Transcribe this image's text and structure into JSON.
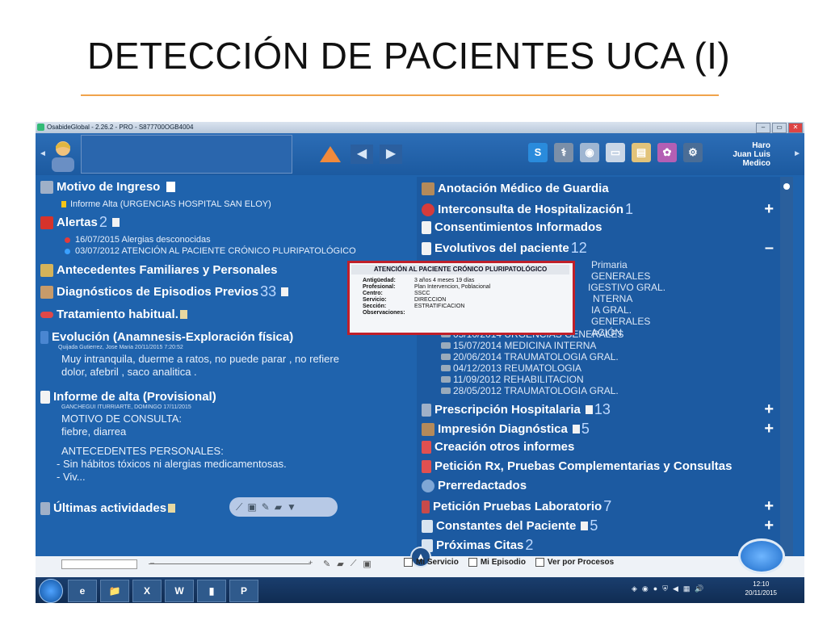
{
  "slide": {
    "title": "DETECCIÓN DE PACIENTES UCA (I)"
  },
  "window": {
    "title": "OsabideGlobal - 2.26.2 - PRO - S877700OGB4004",
    "buttons": [
      "–",
      "▭",
      "✕"
    ]
  },
  "header": {
    "user_name": "Haro",
    "user_first": "Juan Luis",
    "user_role": "Medico",
    "icons": [
      "s-icon",
      "doctor-icon",
      "monitor-icon",
      "card-icon",
      "folder-icon",
      "tree-icon",
      "gear-icon"
    ]
  },
  "left": {
    "motivo_ingreso": "Motivo de Ingreso",
    "informe_alta_urg": "Informe Alta (URGENCIAS HOSPITAL SAN ELOY)",
    "alertas": "Alertas",
    "alertas_count": "2",
    "alert_1": "16/07/2015  Alergias desconocidas",
    "alert_2": "03/07/2012  ATENCIÓN AL PACIENTE CRÓNICO PLURIPATOLÓGICO",
    "antecedentes": "Antecedentes Familiares y Personales",
    "diagnosticos": "Diagnósticos de Episodios Previos",
    "diagnosticos_count": "33",
    "tratamiento": "Tratamiento habitual.",
    "evolucion": "Evolución (Anamnesis-Exploración física)",
    "evolucion_meta": "Quijada Gutierrez, Jose Maria   20/11/2015 7:20:52",
    "evolucion_l1": "Muy intranquila, duerme a ratos, no puede parar , no refiere",
    "evolucion_l2": "dolor, afebril , saco analitica .",
    "informe_alta": "Informe de alta (Provisional)",
    "informe_meta": "GANCHEGUI ITURRIARTE, DOMINGO   17/11/2015",
    "motivo_consulta": "MOTIVO DE CONSULTA:",
    "motivo_val": "fiebre, diarrea",
    "antec_pers": "ANTECEDENTES PERSONALES:",
    "antec_l1": "- Sin hábitos tóxicos ni alergias medicamentosas.",
    "antec_l2": "- Viv...",
    "ultimas": "Últimas actividades"
  },
  "right": {
    "anotacion": "Anotación Médico de Guardia",
    "interconsulta": "Interconsulta de Hospitalización",
    "interconsulta_count": "1",
    "consentimientos": "Consentimientos Informados",
    "evolutivos": "Evolutivos del paciente",
    "evolutivos_count": "12",
    "evolutivos_items": [
      "Primaria",
      "GENERALES",
      "IGESTIVO GRAL.",
      "NTERNA",
      "IA GRAL.",
      "GENERALES",
      "ACIÓN",
      "05/10/2014 URGENCIAS GENERALES",
      "15/07/2014 MEDICINA INTERNA",
      "20/06/2014 TRAUMATOLOGIA GRAL.",
      "04/12/2013 REUMATOLOGIA",
      "11/09/2012 REHABILITACION",
      "28/05/2012 TRAUMATOLOGIA GRAL."
    ],
    "prescripcion": "Prescripción Hospitalaria",
    "prescripcion_count": "13",
    "impresion": "Impresión Diagnóstica",
    "impresion_count": "5",
    "creacion": "Creación otros informes",
    "peticion_rx": "Petición Rx, Pruebas Complementarias y Consultas",
    "prerredactados": "Prerredactados",
    "peticion_lab": "Petición Pruebas Laboratorio",
    "peticion_lab_count": "7",
    "constantes": "Constantes del Paciente",
    "constantes_count": "5",
    "proximas": "Próximas Citas",
    "proximas_count": "2",
    "plus": "+",
    "minus": "–"
  },
  "popup": {
    "title": "ATENCIÓN AL PACIENTE CRÓNICO PLURIPATOLÓGICO",
    "rows": [
      {
        "k": "Antigüedad:",
        "v": "3 años 4 meses 19 días"
      },
      {
        "k": "Profesional:",
        "v": "Plan Intervencion, Poblacional"
      },
      {
        "k": "Centro:",
        "v": "SSCC"
      },
      {
        "k": "Servicio:",
        "v": "DIRECCION"
      },
      {
        "k": "Sección:",
        "v": "ESTRATIFICACION"
      },
      {
        "k": "Observaciones:",
        "v": ""
      }
    ]
  },
  "bottom": {
    "mi_servicio": "Mi Servicio",
    "mi_episodio": "Mi Episodio",
    "ver_procesos": "Ver por Procesos"
  },
  "taskbar": {
    "apps": [
      "e",
      "📁",
      "X",
      "W",
      "▮",
      "P"
    ],
    "time": "12:10",
    "date": "20/11/2015"
  },
  "colors": {
    "panel": "#1f63ad",
    "accent": "#f0a34b",
    "popup_border": "#c0202a"
  }
}
